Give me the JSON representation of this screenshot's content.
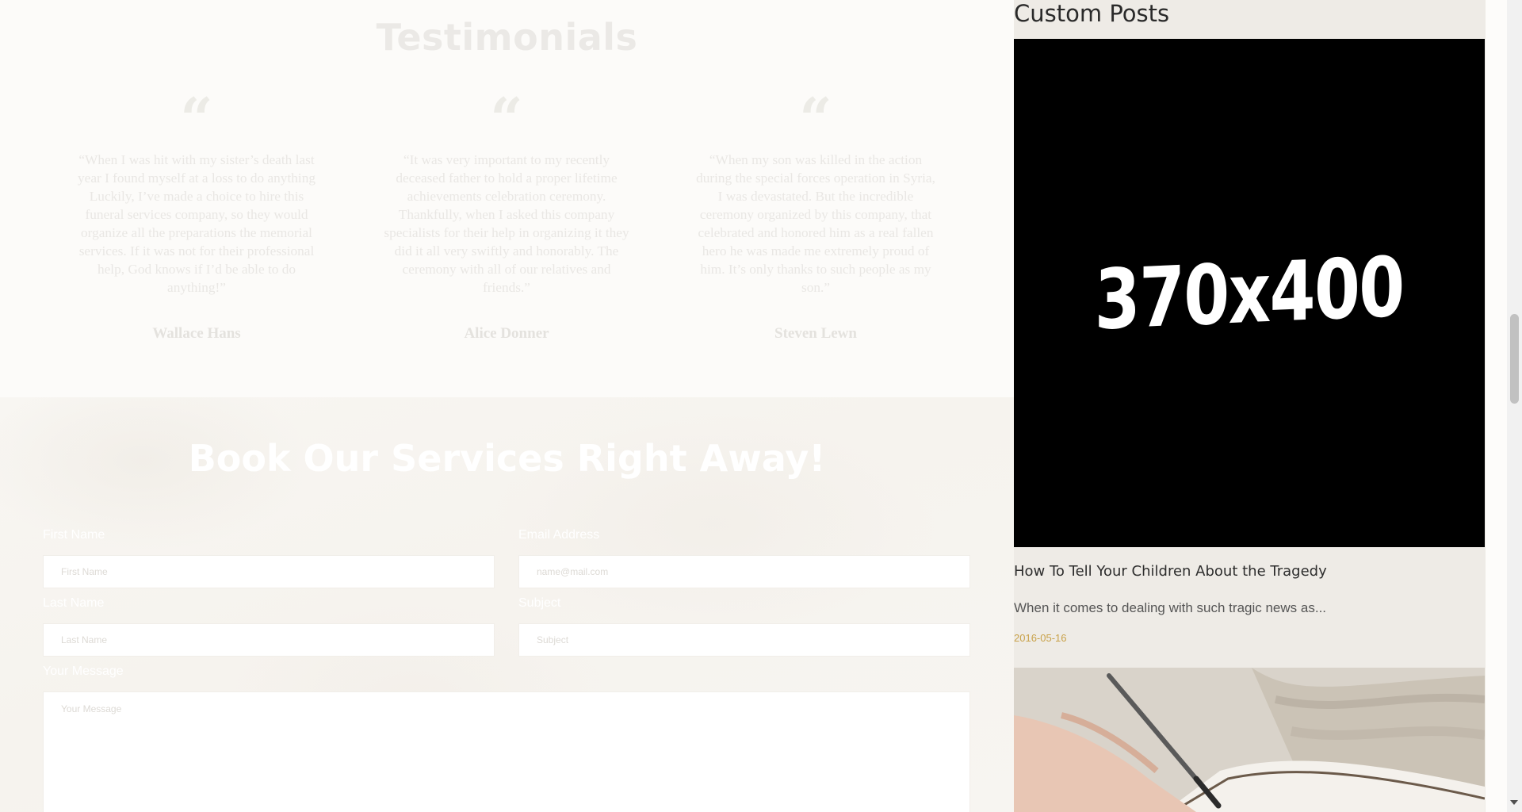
{
  "testimonials": {
    "title": "Testimonials",
    "items": [
      {
        "quote": "“When I was hit with my sister’s death last year I found myself at a loss to do anything Luckily, I’ve made a choice to hire this funeral services company, so they would organize all the preparations the memorial services. If it was not for their professional help, God knows if I’d be able to do anything!”",
        "name": "Wallace Hans"
      },
      {
        "quote": "“It was very important to my recently deceased father to hold a proper lifetime achievements celebration ceremony. Thankfully, when I asked this company specialists for their help in organizing it they did it all very swiftly and honorably. The ceremony with all of our relatives and friends.”",
        "name": "Alice Donner"
      },
      {
        "quote": "“When my son was killed in the action during the special forces operation in Syria, I was devastated. But the incredible ceremony organized by this company, that celebrated and honored him as a real fallen hero he was made me extremely proud of him. It’s only thanks to such people as my son.”",
        "name": "Steven Lewn"
      }
    ]
  },
  "booking": {
    "title": "Book Our Services Right Away!",
    "first_name": {
      "label": "First Name",
      "placeholder": "First Name"
    },
    "email": {
      "label": "Email Address",
      "placeholder": "name@mail.com"
    },
    "last_name": {
      "label": "Last Name",
      "placeholder": "Last Name"
    },
    "subject": {
      "label": "Subject",
      "placeholder": "Subject"
    },
    "message": {
      "label": "Your Message",
      "placeholder": "Your Message"
    }
  },
  "sidebar": {
    "title": "Custom Posts",
    "posts": [
      {
        "image_text": "370x400",
        "title": "How To Tell Your Children About the Tragedy",
        "excerpt": "When it comes to dealing with such tragic news as...",
        "date": "2016-05-16"
      }
    ]
  },
  "colors": {
    "accent_date": "#c9a24a",
    "sidebar_bg": "#eeebe6"
  },
  "icons": {
    "quote": "quote-icon",
    "post2_image": "hand-writing-photo"
  }
}
